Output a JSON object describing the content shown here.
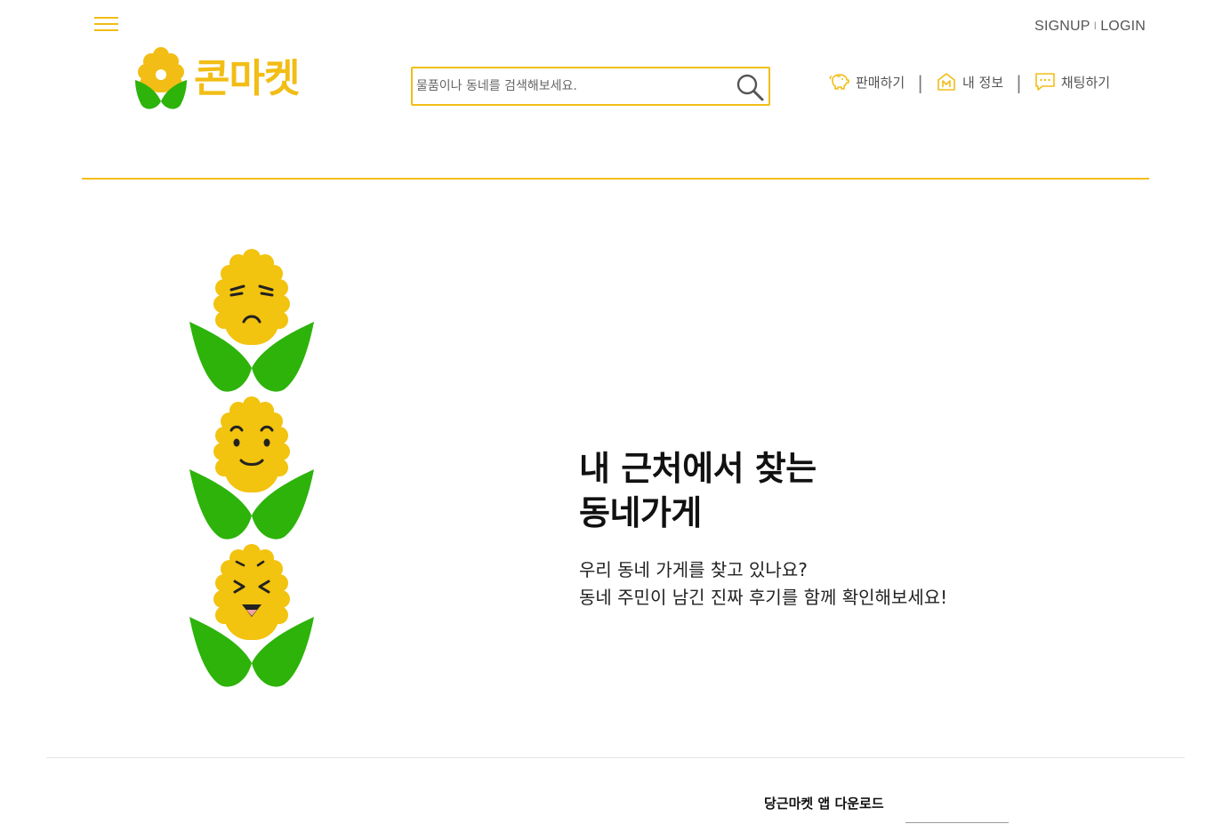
{
  "header": {
    "menu_icon": "hamburger-icon",
    "auth": {
      "signup": "SIGNUP",
      "separator": "I",
      "login": "LOGIN"
    },
    "logo": {
      "text": "콘마켓",
      "icon": "corn-logo-icon"
    },
    "search": {
      "placeholder": "물품이나 동네를 검색해보세요.",
      "value": "",
      "icon": "search-icon"
    },
    "nav": [
      {
        "label": "판매하기",
        "icon": "piggy-bank-icon"
      },
      {
        "label": "내 정보",
        "icon": "my-info-icon"
      },
      {
        "label": "채팅하기",
        "icon": "chat-icon"
      }
    ],
    "nav_separator": "|"
  },
  "hero": {
    "title_line1": "내 근처에서 찾는",
    "title_line2": "동네가게",
    "sub_line1": "우리 동네 가게를 찾고 있나요?",
    "sub_line2": "동네 주민이 남긴 진짜 후기를 함께 확인해보세요!"
  },
  "illustration": {
    "characters": [
      "corn-sad-icon",
      "corn-smile-icon",
      "corn-laugh-icon"
    ]
  },
  "footer": {
    "app_download": "당근마켓 앱 다운로드"
  },
  "colors": {
    "accent": "#f2bd15",
    "leaf": "#2db30a",
    "text": "#222222"
  }
}
